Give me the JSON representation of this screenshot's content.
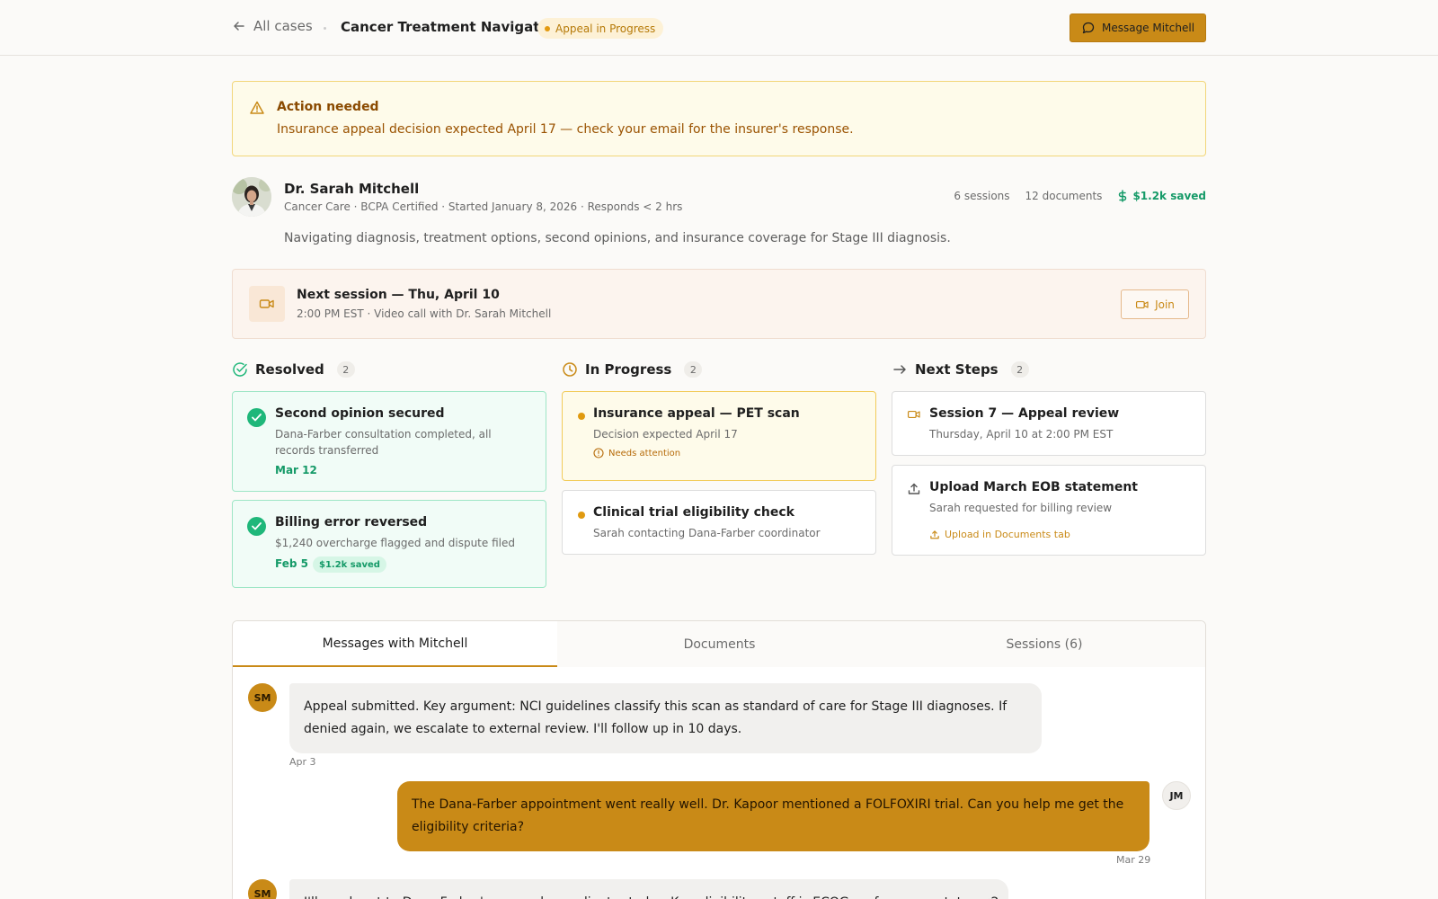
{
  "header": {
    "back_label": "All cases",
    "case_title": "Cancer Treatment Navigation",
    "status": "Appeal in Progress",
    "message_button": "Message Mitchell"
  },
  "alert": {
    "title": "Action needed",
    "text": "Insurance appeal decision expected April 17 — check your email for the insurer's response."
  },
  "provider": {
    "name": "Dr. Sarah Mitchell",
    "meta": "Cancer Care · BCPA Certified · Started January 8, 2026 · Responds < 2 hrs",
    "sessions": "6 sessions",
    "documents": "12 documents",
    "saved": "$1.2k saved",
    "description": "Navigating diagnosis, treatment options, second opinions, and insurance coverage for Stage III diagnosis."
  },
  "next_session": {
    "title": "Next session — Thu, April 10",
    "subtitle": "2:00 PM EST · Video call with Dr. Sarah Mitchell",
    "join_label": "Join"
  },
  "columns": {
    "resolved": {
      "label": "Resolved",
      "count": "2",
      "items": [
        {
          "title": "Second opinion secured",
          "desc": "Dana-Farber consultation completed, all records transferred",
          "date": "Mar 12"
        },
        {
          "title": "Billing error reversed",
          "desc": "$1,240 overcharge flagged and dispute filed",
          "date": "Feb 5",
          "chip": "$1.2k saved"
        }
      ]
    },
    "in_progress": {
      "label": "In Progress",
      "count": "2",
      "items": [
        {
          "title": "Insurance appeal — PET scan",
          "desc": "Decision expected April 17",
          "flag": "Needs attention"
        },
        {
          "title": "Clinical trial eligibility check",
          "desc": "Sarah contacting Dana-Farber coordinator"
        }
      ]
    },
    "next_steps": {
      "label": "Next Steps",
      "count": "2",
      "items": [
        {
          "title": "Session 7 — Appeal review",
          "desc": "Thursday, April 10 at 2:00 PM EST"
        },
        {
          "title": "Upload March EOB statement",
          "desc": "Sarah requested for billing review",
          "link": "Upload in Documents tab"
        }
      ]
    }
  },
  "tabs": [
    {
      "label": "Messages with Mitchell"
    },
    {
      "label": "Documents"
    },
    {
      "label": "Sessions (6)"
    }
  ],
  "messages": [
    {
      "initials": "SM",
      "text": "Appeal submitted. Key argument: NCI guidelines classify this scan as standard of care for Stage III diagnoses. If denied again, we escalate to external review. I'll follow up in 10 days.",
      "date": "Apr 3"
    },
    {
      "initials": "JM",
      "text": "The Dana-Farber appointment went really well. Dr. Kapoor mentioned a FOLFOXIRI trial. Can you help me get the eligibility criteria?",
      "date": "Mar 29"
    },
    {
      "initials": "SM",
      "text": "I'll reach out to Dana-Farber's research coordinator today. Key eligibility cutoff is ECOG performance status ≤2."
    }
  ],
  "colors": {
    "accent": "#c98a17",
    "resolved_green": "#1fb77a",
    "warning_bg": "#fefbea"
  },
  "icons": [
    "arrow-left-icon",
    "chat-bubble-icon",
    "warning-triangle-icon",
    "dollar-icon",
    "video-camera-icon",
    "check-circle-icon",
    "clock-icon",
    "arrow-right-icon",
    "upload-icon",
    "alert-circle-icon"
  ]
}
